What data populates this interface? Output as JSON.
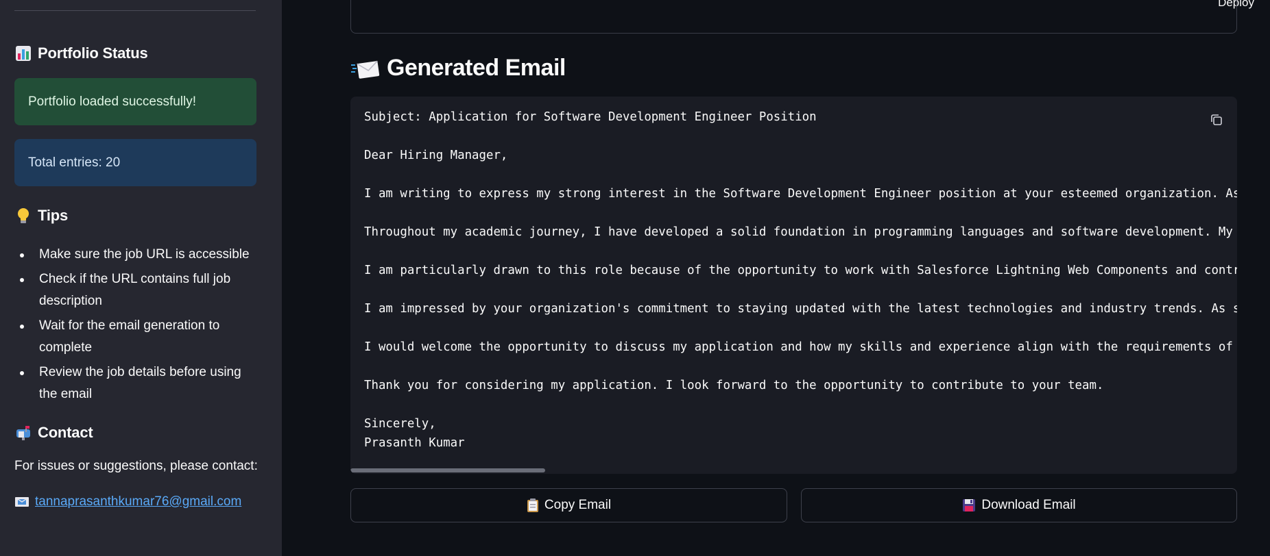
{
  "header": {
    "deploy_label": "Deploy"
  },
  "sidebar": {
    "portfolio_heading": "Portfolio Status",
    "success_message": "Portfolio loaded successfully!",
    "total_entries": "Total entries: 20",
    "tips_heading": "Tips",
    "tips": [
      "Make sure the job URL is accessible",
      "Check if the URL contains full job description",
      "Wait for the email generation to complete",
      "Review the job details before using the email"
    ],
    "contact_heading": "Contact",
    "contact_text": "For issues or suggestions, please contact:",
    "contact_email": "tannaprasanthkumar76@gmail.com",
    "icons": {
      "portfolio": "bar-chart-icon",
      "tips": "lightbulb-icon",
      "contact": "mailbox-icon",
      "email": "envelope-icon"
    }
  },
  "main": {
    "section_title": "Generated Email",
    "section_icon": "incoming-envelope-icon",
    "email_text": "Subject: Application for Software Development Engineer Position\n\nDear Hiring Manager,\n\nI am writing to express my strong interest in the Software Development Engineer position at your esteemed organization. As\n\nThroughout my academic journey, I have developed a solid foundation in programming languages and software development. My\n\nI am particularly drawn to this role because of the opportunity to work with Salesforce Lightning Web Components and contr\n\nI am impressed by your organization's commitment to staying updated with the latest technologies and industry trends. As s\n\nI would welcome the opportunity to discuss my application and how my skills and experience align with the requirements of\n\nThank you for considering my application. I look forward to the opportunity to contribute to your team.\n\nSincerely,\nPrasanth Kumar",
    "copy_button": "Copy Email",
    "download_button": "Download Email"
  },
  "colors": {
    "background": "#0e1117",
    "sidebar": "#262730",
    "success_bg": "#224e37",
    "info_bg": "#1e3a5a",
    "link": "#5aa9f7",
    "code_bg": "#1a1c24"
  }
}
